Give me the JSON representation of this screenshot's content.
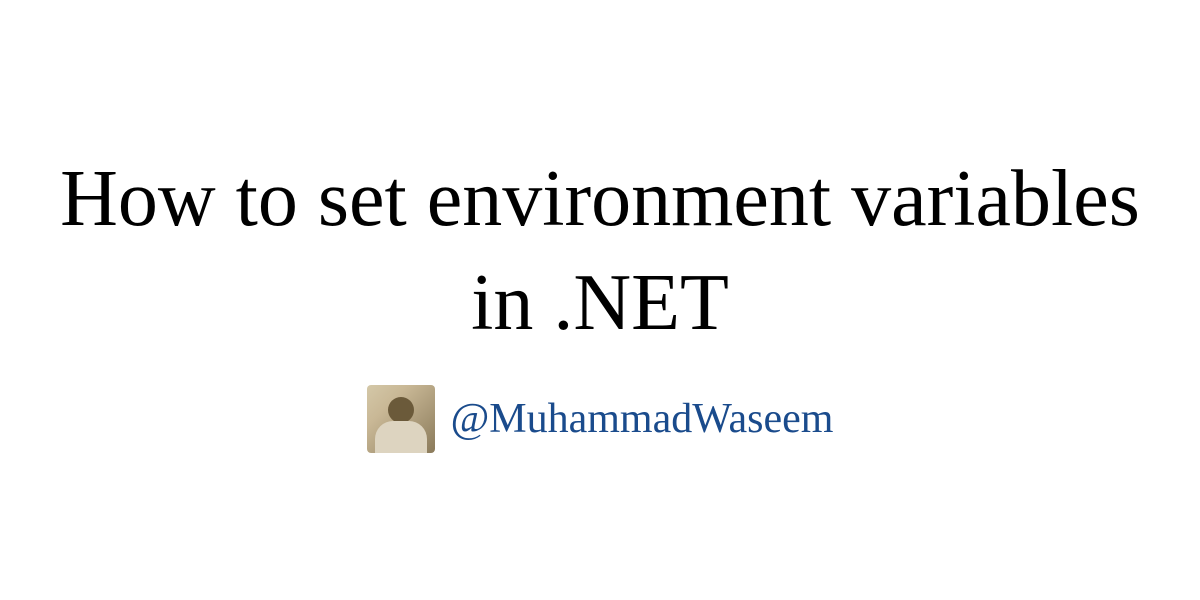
{
  "title": "How to set environment variables in .NET",
  "author": {
    "handle": "@MuhammadWaseem"
  },
  "colors": {
    "title_color": "#000000",
    "handle_color": "#1a4b8c",
    "background": "#ffffff"
  }
}
